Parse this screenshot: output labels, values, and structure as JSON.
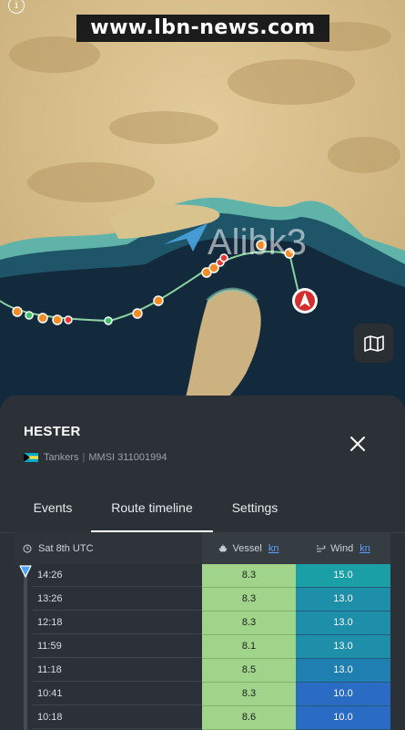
{
  "watermark": "www.lbn-news.com",
  "map_logo": "Alibk3",
  "vessel": {
    "name": "HESTER",
    "type": "Tankers",
    "mmsi_label": "MMSI",
    "mmsi": "311001994"
  },
  "tabs": [
    {
      "label": "Events",
      "active": false
    },
    {
      "label": "Route timeline",
      "active": true
    },
    {
      "label": "Settings",
      "active": false
    }
  ],
  "table": {
    "date_header": "Sat 8th UTC",
    "vessel_header": "Vessel",
    "wind_header": "Wind",
    "unit": "kn",
    "rows": [
      {
        "time": "14:26",
        "vessel": "8.3",
        "wind": "15.0",
        "wind_color": "#1a9fa6"
      },
      {
        "time": "13:26",
        "vessel": "8.3",
        "wind": "13.0",
        "wind_color": "#1e8fa8"
      },
      {
        "time": "12:18",
        "vessel": "8.3",
        "wind": "13.0",
        "wind_color": "#1e8fa8"
      },
      {
        "time": "11:59",
        "vessel": "8.1",
        "wind": "13.0",
        "wind_color": "#1e8fa8"
      },
      {
        "time": "11:18",
        "vessel": "8.5",
        "wind": "13.0",
        "wind_color": "#1e7fb0"
      },
      {
        "time": "10:41",
        "vessel": "8.3",
        "wind": "10.0",
        "wind_color": "#2a6cc4"
      },
      {
        "time": "10:18",
        "vessel": "8.6",
        "wind": "10.0",
        "wind_color": "#2a6cc4"
      }
    ]
  },
  "icons": {
    "info": "info-icon",
    "map_layers": "map-icon",
    "close": "close-icon",
    "clock": "clock-icon",
    "ship": "ship-icon",
    "wind": "wind-icon",
    "timeline_handle": "timeline-handle-icon",
    "vessel_marker": "vessel-position-icon"
  }
}
